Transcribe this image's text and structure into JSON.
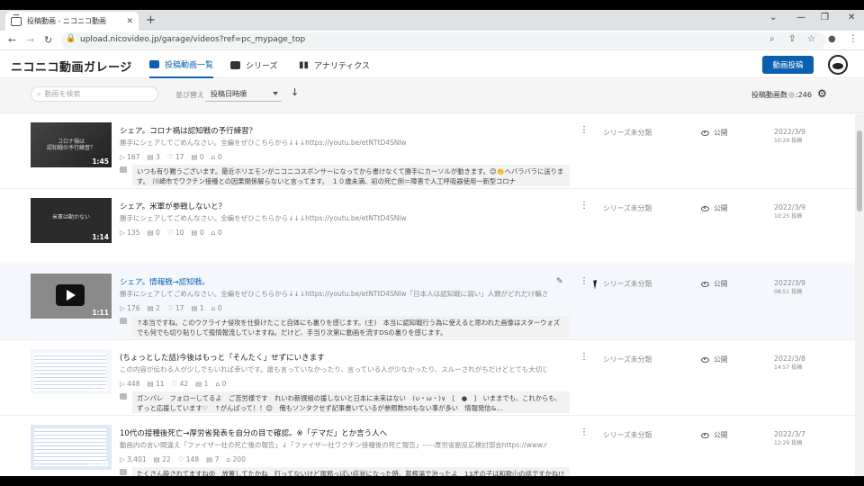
{
  "browser": {
    "tab_title": "投稿動画 - ニコニコ動画",
    "url": "upload.nicovideo.jp/garage/videos?ref=pc_mypage_top"
  },
  "app": {
    "logo": "ニコニコ動画ガレージ",
    "nav": [
      {
        "label": "投稿動画一覧",
        "active": true
      },
      {
        "label": "シリーズ",
        "active": false
      },
      {
        "label": "アナリティクス",
        "active": false
      }
    ],
    "post_button": "動画投稿"
  },
  "toolbar": {
    "search_placeholder": "動画を検索",
    "sort_label": "並び替え",
    "sort_value": "投稿日時順",
    "sort_direction": "↓",
    "count_label": "投稿動画数",
    "count_value": ":246"
  },
  "videos": [
    {
      "title": "シェア。コロナ禍は認知戦の予行練習？",
      "desc": "勝手にシェアしてごめんなさい。全編をぜひこちらから↓↓↓https://youtu.be/etNTtD4SNlw",
      "stats": [
        "167",
        "3",
        "17",
        "0",
        "0"
      ],
      "duration": "1:45",
      "thumb_caption": "コロナ禍は\n認知戦の予行練習？",
      "comment": "いつも有り難うございます。最近ホリエモンがニコニコスポンサーになってから書けなくて勝手にカーソルが動きます。😊👏ヘバラバラに送ります。　川崎市でワクチン接種との因果関係解らないと言ってます。　１０歳未満、初の死亡例＝障害で人工呼吸器使用一新型コロナ",
      "series": "シリーズ未分類",
      "status": "公開",
      "date": "2022/3/9",
      "time": "10:29 投稿"
    },
    {
      "title": "シェア。米軍が参戦しないと？",
      "desc": "勝手にシェアしてごめんなさい。全編をぜひこちらから↓↓↓https://youtu.be/etNTtD4SNlw",
      "stats": [
        "135",
        "0",
        "10",
        "0",
        "0"
      ],
      "duration": "1:14",
      "thumb_caption": "米軍は動かない",
      "comment": "",
      "series": "シリーズ未分類",
      "status": "公開",
      "date": "2022/3/9",
      "time": "10:25 投稿"
    },
    {
      "title": "シェア。情報戦→認知戦。",
      "desc": "勝手にシェアしてごめんなさい。全編をぜひこちらから↓↓↓https://youtu.be/etNTtD4SNlw「日本人は認知戦に弱い」人類がどれだけ騙されないかで…",
      "stats": [
        "176",
        "2",
        "17",
        "1",
        "0"
      ],
      "duration": "1:11",
      "thumb_caption": "",
      "comment": "↑本当ですね。このウクライナ侵攻を仕掛けたこと自体にも裏りを感じます。(主)　本当に認知戦行う為に使えると思われた画像はスターウォズでも何でも切り貼りして殖情報流していますね。だけど、手当り次第に動画を流すDSの裏りを感じます。",
      "series": "シリーズ未分類",
      "status": "公開",
      "date": "2022/3/9",
      "time": "08:51 投稿"
    },
    {
      "title": "(ちょっとした話)今後はもっと「そんたく」せずにいきます",
      "desc": "この内容が伝わる人が少しでもいれば幸いです。誰も言っていなかったり、言っている人が少なかったり、スルーされがちだけどとても大切じゃないかっていうよ…",
      "stats": [
        "448",
        "11",
        "42",
        "1",
        "0"
      ],
      "duration": "5:56",
      "thumb_caption": "",
      "comment": "ガンバレ　フォローしてるよ　ご苦労様です　れいわ新撰組の援しないと日本に未来はない　(∪・ω・)∨　[　●　]　いままでも、これからも、ずっと応援しています♡　↑がんばって！！😊　俺もソンタクせず記事書いているが参照数50もない事が多い　情報発信&…",
      "series": "シリーズ未分類",
      "status": "公開",
      "date": "2022/3/8",
      "time": "14:57 投稿"
    },
    {
      "title": "10代の接種後死亡→厚労省発表を自分の目で確認。※「デマだ」とか言う人へ",
      "desc": "動画内の言い間違え「ファイザー社の死亡後の報告」↓「ファイザー社ワクチン接種後の死亡報告」-----厚労省副反応検討部会https://www.mhlw.go.jp/stf/shi…",
      "stats": [
        "3,401",
        "22",
        "148",
        "7",
        "200"
      ],
      "duration": "11:43",
      "thumb_caption": "",
      "comment": "たくさん殺されてますね😵　放置してたかね　打ってないけど風邪っぽい症状になった時、葛根湯で治ったよ　13才の子は和歌山の話ですかね!?この件を内部告発したこーろーしょーの職員が、電車にひかれたとか…💣⚡　続編:鹿先生のチャンネル見ましょう　お疲れ",
      "series": "シリーズ未分類",
      "status": "公開",
      "date": "2022/3/7",
      "time": "12:29 投稿"
    }
  ]
}
